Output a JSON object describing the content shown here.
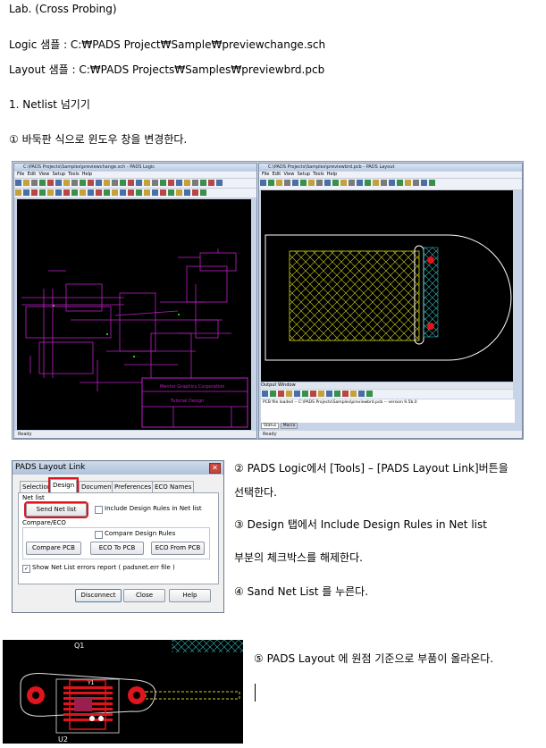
{
  "doc": {
    "heading": "Lab. (Cross Probing)",
    "logic_line": "Logic 샘플 : C:₩PADS Project₩Sample₩previewchange.sch",
    "layout_line": "Layout 샘플 : C:₩PADS Projects₩Samples₩previewbrd.pcb",
    "section_title": "1.   Netlist 넘기기",
    "step1": "① 바둑판 식으로 윈도우 창을 변경한다.",
    "step2a": "② PADS Logic에서 [Tools] – [PADS Layout Link]버튼을",
    "step2b": "선택한다.",
    "step3a": "③ Design 탭에서 Include Design Rules in Net list",
    "step3b": "부분의 체크박스를 해제한다.",
    "step4": "④ Sand Net List 를 누른다.",
    "step5": "⑤ PADS Layout 에 원점 기준으로 부품이 올라온다."
  },
  "logic_window": {
    "title": "C:\\PADS Projects\\Samples\\previewchange.sch - PADS Logic",
    "menu": [
      "File",
      "Edit",
      "View",
      "Setup",
      "Tools",
      "Help"
    ],
    "title_block": {
      "company": "Mentor Graphics Corporation",
      "design": "Tutorial Design"
    },
    "status": "Ready"
  },
  "layout_window": {
    "title": "C:\\PADS Projects\\Samples\\previewbrd.pcb - PADS Layout",
    "menu": [
      "File",
      "Edit",
      "View",
      "Setup",
      "Tools",
      "Help"
    ],
    "output_title": "Output Window",
    "output_line1": "PCB file loaded -- C:\\PADS Projects\\Samples\\previewbrd.pcb -- version 9.5b.0",
    "output_tabs": [
      "Status",
      "Macro"
    ],
    "status": "Ready"
  },
  "dialog": {
    "title": "PADS Layout Link",
    "tabs": [
      "Selection",
      "Design",
      "Document",
      "Preferences",
      "ECO Names"
    ],
    "netlist_label": "Net list",
    "send_netlist": "Send Net list",
    "include_rules": "Include Design Rules in Net list",
    "compare_label": "Compare/ECO",
    "compare_rules": "Compare Design Rules",
    "compare_pcb": "Compare PCB",
    "eco_to_pcb": "ECO To PCB",
    "eco_from_pcb": "ECO From PCB",
    "show_errors": "Show Net List errors report ( padsnet.err file )",
    "disconnect": "Disconnect",
    "close": "Close",
    "help": "Help"
  },
  "pcb_view": {
    "q1": "Q1",
    "u2": "U2",
    "y1": "Y1"
  },
  "colors": {
    "accent_red": "#e0141c",
    "schematic": "#c01ec8",
    "yellow": "#d6d61e",
    "cyan": "#36b6b6"
  }
}
